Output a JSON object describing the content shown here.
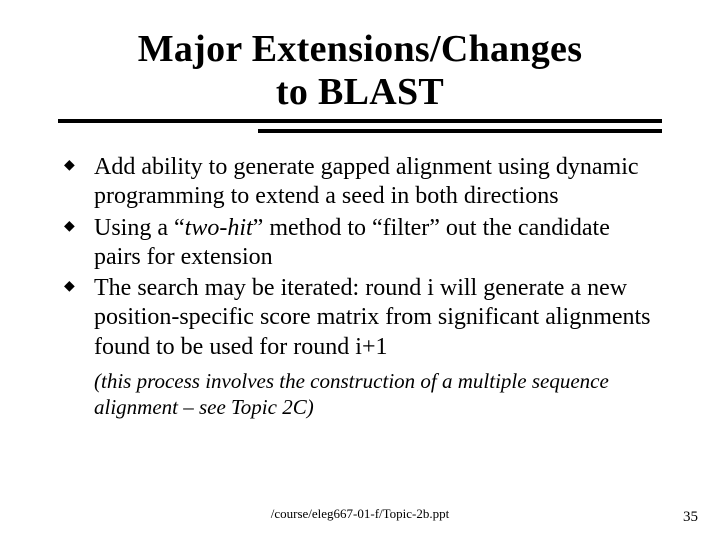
{
  "title": {
    "line1": "Major Extensions/Changes",
    "line2": "to BLAST"
  },
  "bullets": [
    {
      "pre": "Add ability to generate gapped alignment using dynamic programming to extend a seed in both directions",
      "em": "",
      "post": ""
    },
    {
      "pre": "Using a “",
      "em": "two-hit",
      "post": "” method to “filter” out the candidate pairs for extension"
    },
    {
      "pre": "The search may be iterated: round i will generate a new position-specific score matrix from significant alignments found to be used for round i+1",
      "em": "",
      "post": ""
    }
  ],
  "subnote": "(this process involves the construction of a multiple sequence alignment – see Topic 2C)",
  "footer": {
    "path": "/course/eleg667-01-f/Topic-2b.ppt",
    "page": "35"
  }
}
